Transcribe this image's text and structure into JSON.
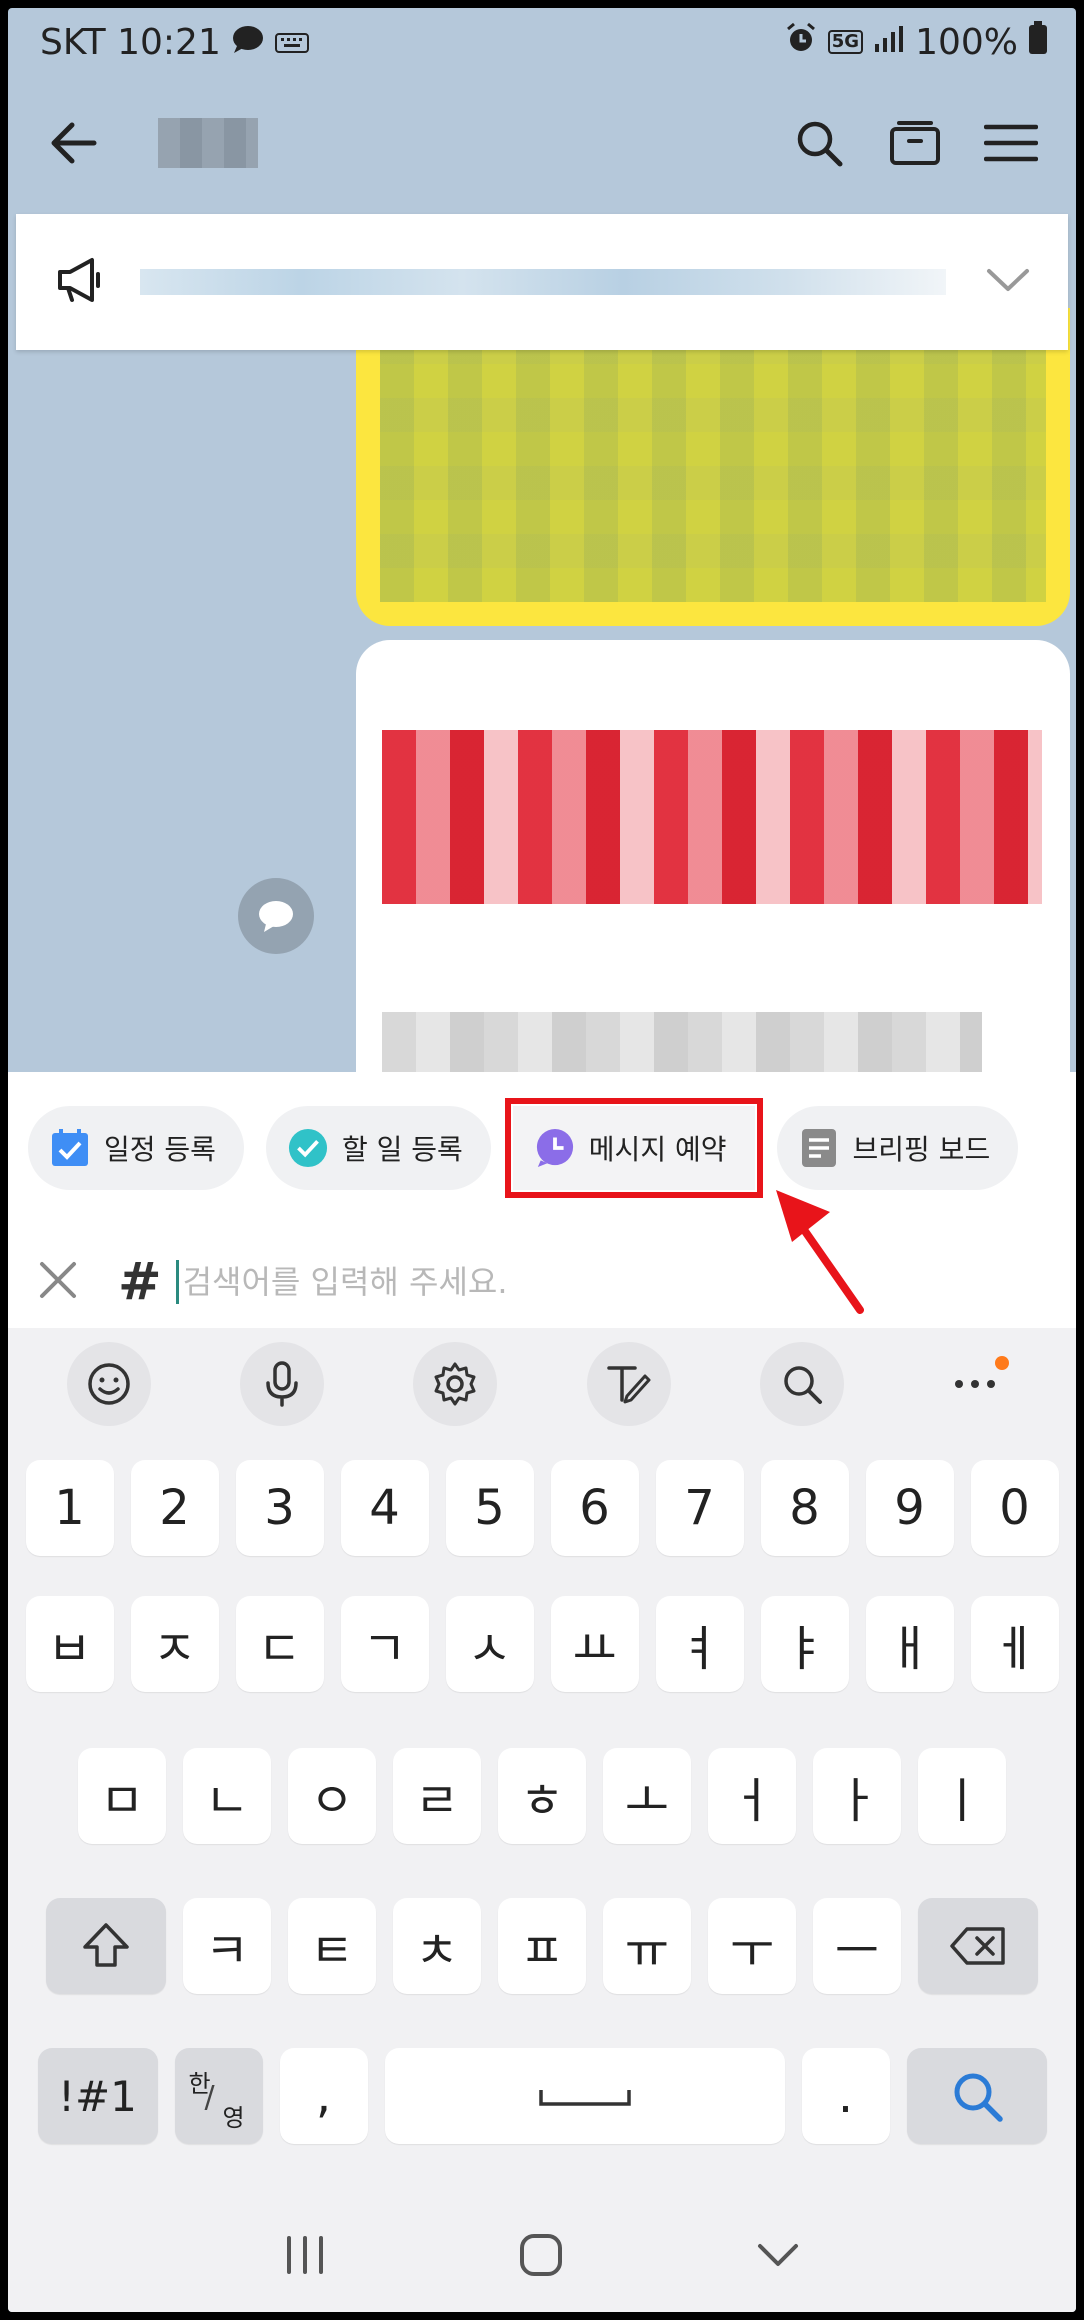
{
  "status_bar": {
    "carrier_time": "SKT 10:21",
    "network": "5G",
    "battery": "100%"
  },
  "chips": [
    {
      "label": "일정 등록",
      "icon": "calendar-check-icon",
      "color": "#3f8ef5"
    },
    {
      "label": "할 일 등록",
      "icon": "todo-check-icon",
      "color": "#30c2c8"
    },
    {
      "label": "메시지 예약",
      "icon": "clock-bubble-icon",
      "color": "#8b6de8"
    },
    {
      "label": "브리핑 보드",
      "icon": "document-icon",
      "color": "#8a8a8a"
    }
  ],
  "search": {
    "prefix": "#",
    "placeholder": "검색어를 입력해 주세요."
  },
  "keyboard": {
    "numbers": [
      "1",
      "2",
      "3",
      "4",
      "5",
      "6",
      "7",
      "8",
      "9",
      "0"
    ],
    "row1": [
      "ㅂ",
      "ㅈ",
      "ㄷ",
      "ㄱ",
      "ㅅ",
      "ㅛ",
      "ㅕ",
      "ㅑ",
      "ㅐ",
      "ㅔ"
    ],
    "row2": [
      "ㅁ",
      "ㄴ",
      "ㅇ",
      "ㄹ",
      "ㅎ",
      "ㅗ",
      "ㅓ",
      "ㅏ",
      "ㅣ"
    ],
    "row3": [
      "ㅋ",
      "ㅌ",
      "ㅊ",
      "ㅍ",
      "ㅠ",
      "ㅜ",
      "ㅡ"
    ],
    "symbols_key": "!#1",
    "lang_key_top": "한",
    "lang_key_bottom": "영",
    "comma": ",",
    "period": "."
  },
  "colors": {
    "highlight_box": "#e8141a",
    "accent_search": "#2b7bd6"
  }
}
